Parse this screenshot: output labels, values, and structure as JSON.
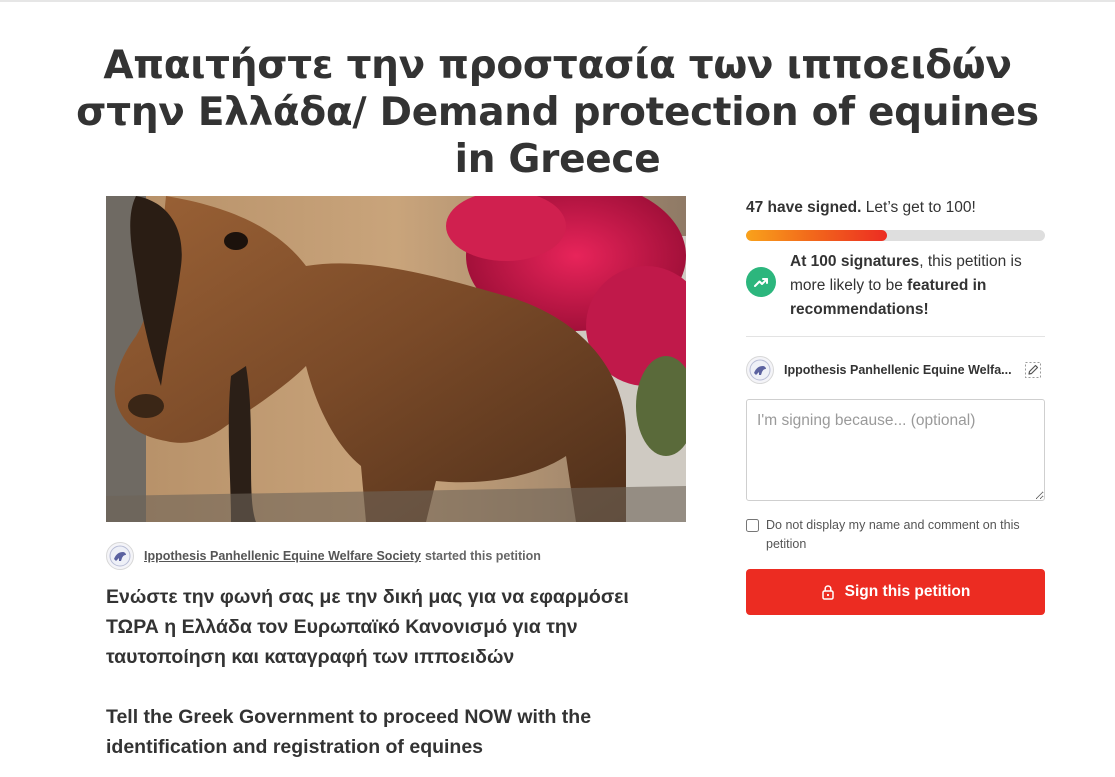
{
  "page": {
    "title": "Απαιτήστε την προστασία των ιπποειδών στην Ελλάδα/ Demand protection of equines in Greece"
  },
  "hero_image": {
    "icon": "horse-photo"
  },
  "starter": {
    "organization": "Ippothesis Panhellenic Equine Welfare Society",
    "action": "started this petition"
  },
  "body": {
    "paragraph_greek": "Ενώστε την φωνή σας με την δική μας για να εφαρμόσει ΤΩΡΑ η Ελλάδα τον Ευρωπαϊκό Κανονισμό για την ταυτοποίηση και καταγραφή των ιπποειδών",
    "paragraph_english": "Tell the Greek Government to proceed NOW with the identification and registration of equines"
  },
  "signatures": {
    "count_text": "47 have signed.",
    "goal_text": "Let’s get to 100!",
    "progress_fraction": 0.47,
    "progress_colors": [
      "#f9a21b",
      "#ec2c22"
    ]
  },
  "milestone": {
    "icon": "trending-up-icon",
    "lead": "At 100 signatures",
    "middle": ", this petition is more likely to be ",
    "emphasis": "featured in recommendations!"
  },
  "signer": {
    "name": "Ippothesis Panhellenic Equine Welfa...",
    "edit_icon": "pencil-icon"
  },
  "form": {
    "comment_placeholder": "I'm signing because... (optional)",
    "hide_name_label": "Do not display my name and comment on this petition",
    "sign_button_label": "Sign this petition",
    "sign_button_icon": "lock-icon"
  },
  "colors": {
    "accent_red": "#ec2c22",
    "success_green": "#2cb67d"
  }
}
